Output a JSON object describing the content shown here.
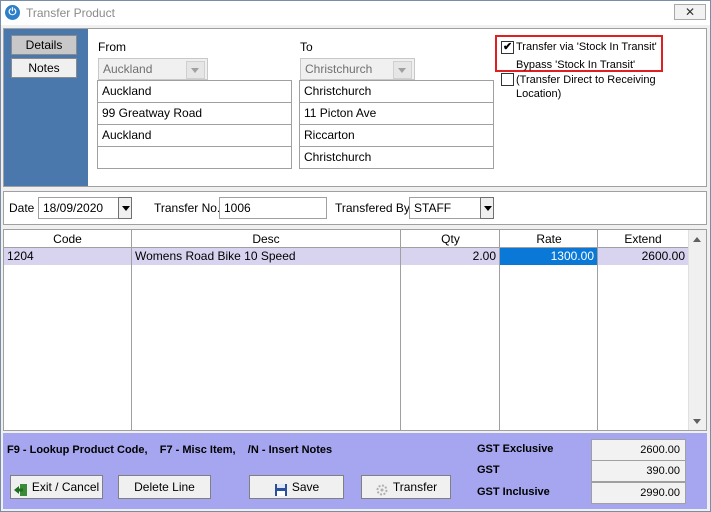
{
  "window": {
    "title": "Transfer Product",
    "close_glyph": "✕"
  },
  "side_tabs": {
    "details": "Details",
    "notes": "Notes"
  },
  "from": {
    "label": "From",
    "location": "Auckland",
    "address1": "Auckland",
    "address2": "99 Greatway Road",
    "address3": "Auckland",
    "address4": ""
  },
  "to": {
    "label": "To",
    "location": "Christchurch",
    "address1": "Christchurch",
    "address2": "11 Picton Ave",
    "address3": "Riccarton",
    "address4": "Christchurch"
  },
  "options": {
    "via_transit_label": "Transfer via 'Stock In Transit'",
    "via_transit_checked": true,
    "bypass_label_1": "Bypass 'Stock In Transit'",
    "bypass_label_2": "(Transfer Direct to Receiving",
    "bypass_label_3": "Location)",
    "bypass_checked": false
  },
  "header_fields": {
    "date_label": "Date",
    "date_value": "18/09/2020",
    "transfer_no_label": "Transfer No.",
    "transfer_no_value": "1006",
    "transfered_by_label": "Transfered By",
    "transfered_by_value": "STAFF"
  },
  "grid": {
    "columns": {
      "code": "Code",
      "desc": "Desc",
      "qty": "Qty",
      "rate": "Rate",
      "extend": "Extend"
    },
    "rows": [
      {
        "code": "1204",
        "desc": "Womens Road Bike 10 Speed",
        "qty": "2.00",
        "rate": "1300.00",
        "extend": "2600.00"
      }
    ]
  },
  "hints": "F9 - Lookup Product Code,    F7 - Misc Item,    /N - Insert Notes",
  "totals": {
    "gst_exclusive_label": "GST Exclusive",
    "gst_exclusive_value": "2600.00",
    "gst_label": "GST",
    "gst_value": "390.00",
    "gst_inclusive_label": "GST Inclusive",
    "gst_inclusive_value": "2990.00"
  },
  "buttons": {
    "exit_cancel": "Exit / Cancel",
    "delete_line": "Delete Line",
    "save": "Save",
    "transfer": "Transfer"
  },
  "colors": {
    "side_strip": "#4a78ad",
    "footer": "#a6a6f0",
    "row_highlight": "#d8d4f0",
    "selected_cell": "#0a78d7",
    "highlight_border": "#e02020"
  }
}
